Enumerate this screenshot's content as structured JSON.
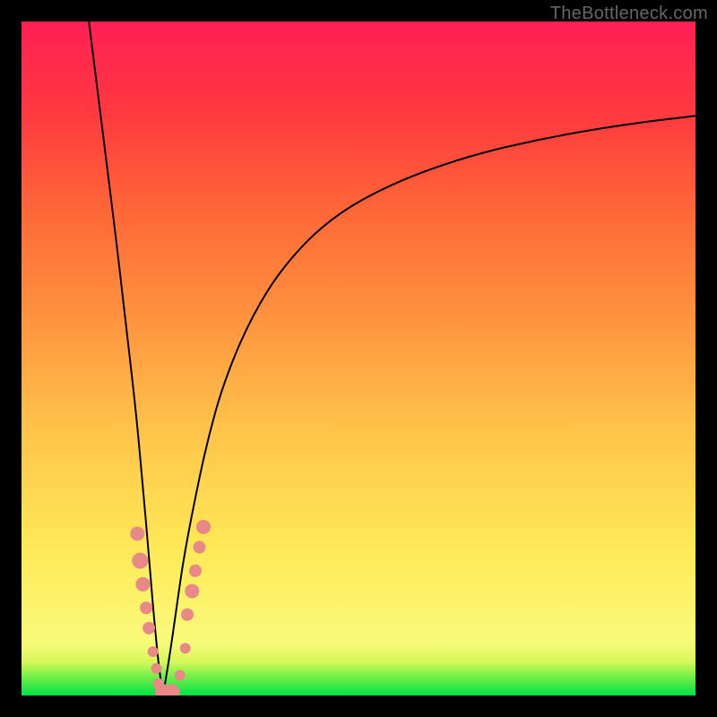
{
  "watermark": "TheBottleneck.com",
  "chart_data": {
    "type": "line",
    "title": "",
    "xlabel": "",
    "ylabel": "",
    "xlim": [
      0,
      100
    ],
    "ylim": [
      0,
      100
    ],
    "gradient_stops": [
      {
        "offset": 0.0,
        "color": "#00e343"
      },
      {
        "offset": 0.03,
        "color": "#7cf04a"
      },
      {
        "offset": 0.05,
        "color": "#d7f85a"
      },
      {
        "offset": 0.08,
        "color": "#f9fa7a"
      },
      {
        "offset": 0.22,
        "color": "#ffe956"
      },
      {
        "offset": 0.4,
        "color": "#ffc24a"
      },
      {
        "offset": 0.55,
        "color": "#ff963f"
      },
      {
        "offset": 0.72,
        "color": "#ff6737"
      },
      {
        "offset": 0.86,
        "color": "#ff3a3f"
      },
      {
        "offset": 1.0,
        "color": "#ff1f55"
      }
    ],
    "curve_color": "#000000",
    "curve_width": 2,
    "series": [
      {
        "name": "left-branch",
        "x": [
          10.0,
          12.0,
          14.0,
          15.5,
          17.0,
          18.0,
          18.8,
          19.4,
          19.9,
          20.3,
          20.7,
          21.0
        ],
        "y": [
          100.0,
          84.0,
          68.0,
          55.0,
          42.0,
          31.0,
          22.0,
          14.5,
          9.0,
          5.0,
          2.0,
          0.0
        ]
      },
      {
        "name": "right-branch",
        "x": [
          21.0,
          22.0,
          23.0,
          24.0,
          25.5,
          27.5,
          30.0,
          34.0,
          39.0,
          46.0,
          55.0,
          66.0,
          78.0,
          90.0,
          100.0
        ],
        "y": [
          0.0,
          6.0,
          13.0,
          20.0,
          28.0,
          37.5,
          46.5,
          56.0,
          64.0,
          71.0,
          76.0,
          80.0,
          82.8,
          84.8,
          86.0
        ]
      }
    ],
    "markers": {
      "color": "#e98987",
      "radius_small": 6,
      "radius_large": 9,
      "points": [
        {
          "x": 17.2,
          "y": 24.0,
          "r": 8
        },
        {
          "x": 17.6,
          "y": 20.0,
          "r": 9
        },
        {
          "x": 18.0,
          "y": 16.5,
          "r": 8
        },
        {
          "x": 18.5,
          "y": 13.0,
          "r": 7
        },
        {
          "x": 18.9,
          "y": 10.0,
          "r": 7
        },
        {
          "x": 19.5,
          "y": 6.5,
          "r": 6
        },
        {
          "x": 20.0,
          "y": 4.0,
          "r": 6
        },
        {
          "x": 20.3,
          "y": 1.8,
          "r": 6
        },
        {
          "x": 21.0,
          "y": 0.5,
          "r": 9
        },
        {
          "x": 22.3,
          "y": 0.5,
          "r": 9
        },
        {
          "x": 23.5,
          "y": 3.0,
          "r": 6
        },
        {
          "x": 24.3,
          "y": 7.0,
          "r": 6
        },
        {
          "x": 24.6,
          "y": 12.0,
          "r": 7
        },
        {
          "x": 25.3,
          "y": 15.5,
          "r": 8
        },
        {
          "x": 25.8,
          "y": 18.5,
          "r": 7
        },
        {
          "x": 26.4,
          "y": 22.0,
          "r": 7
        },
        {
          "x": 27.0,
          "y": 25.0,
          "r": 8
        }
      ]
    }
  }
}
